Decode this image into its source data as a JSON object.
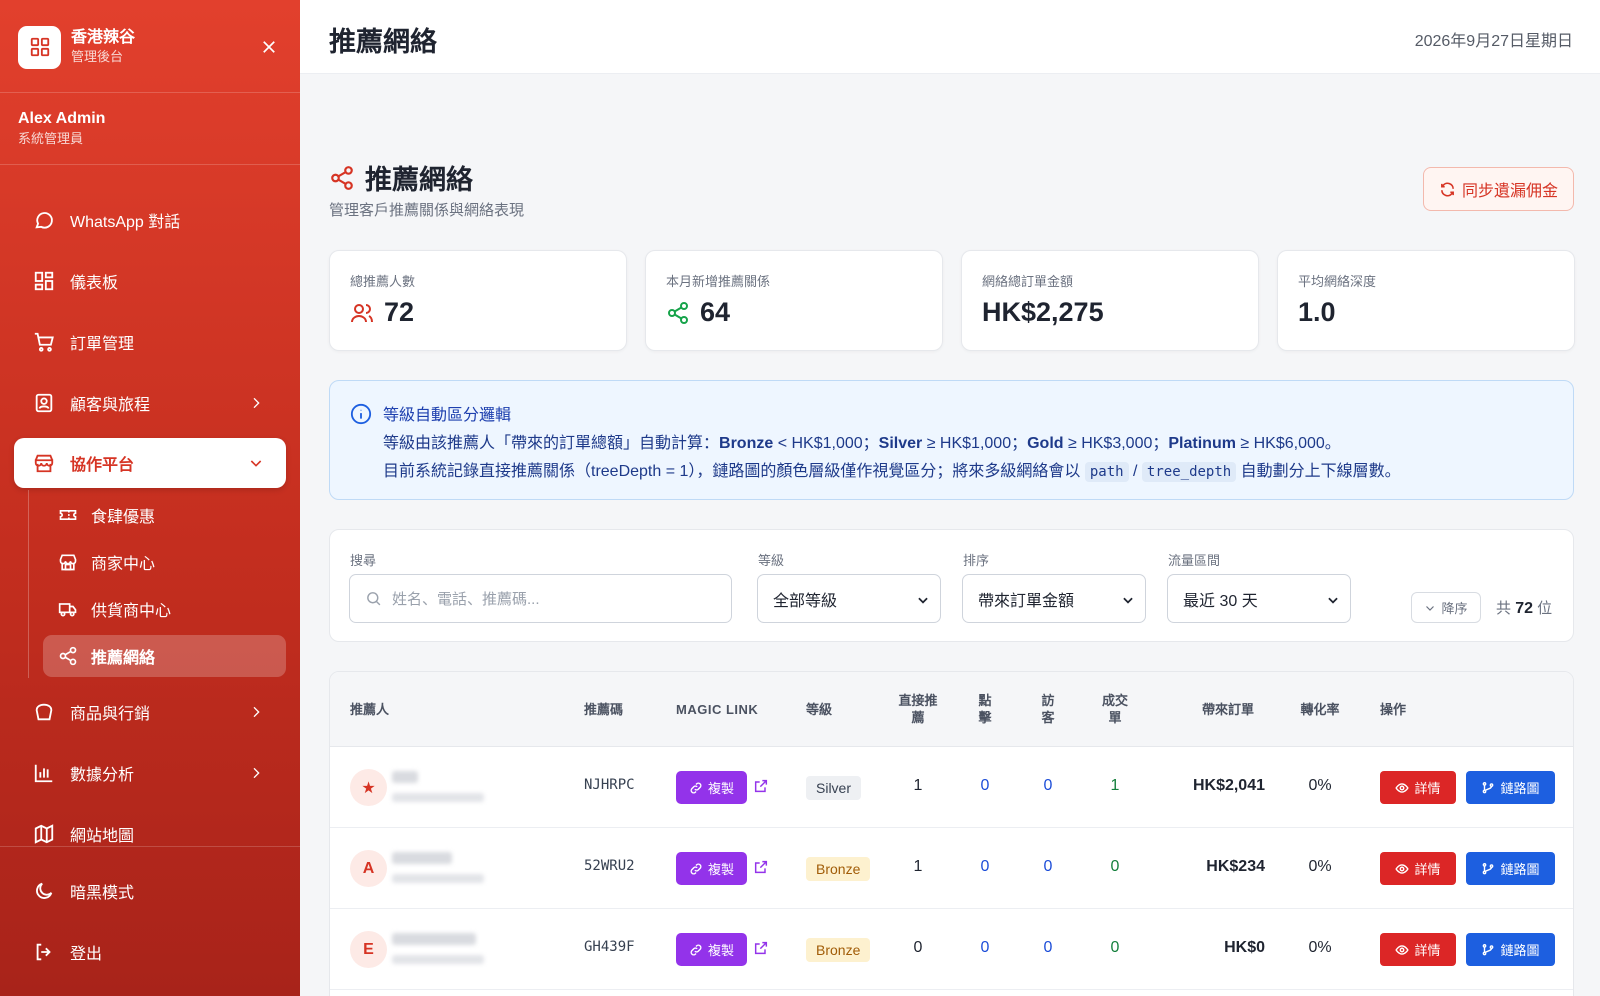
{
  "brand": {
    "name": "香港辣谷",
    "sub": "管理後台"
  },
  "user": {
    "name": "Alex Admin",
    "role": "系統管理員"
  },
  "nav": {
    "whatsapp": "WhatsApp 對話",
    "dashboard": "儀表板",
    "orders": "訂單管理",
    "customers": "顧客與旅程",
    "partners": "協作平台",
    "partner_sub": {
      "coupons": "食肆優惠",
      "merchants": "商家中心",
      "suppliers": "供貨商中心",
      "referrals": "推薦網絡"
    },
    "products": "商品與行銷",
    "analytics": "數據分析",
    "sitemap": "網站地圖",
    "dark_mode": "暗黑模式",
    "logout": "登出"
  },
  "header": {
    "title": "推薦網絡",
    "date": "2026年9月27日星期日"
  },
  "page": {
    "title": "推薦網絡",
    "subtitle": "管理客戶推薦關係與網絡表現",
    "sync_label": "同步遺漏佣金"
  },
  "stats": [
    {
      "label": "總推薦人數",
      "value": "72"
    },
    {
      "label": "本月新增推薦關係",
      "value": "64"
    },
    {
      "label": "網絡總訂單金額",
      "value": "HK$2,275"
    },
    {
      "label": "平均網絡深度",
      "value": "1.0"
    }
  ],
  "info": {
    "title": "等級自動區分邏輯",
    "line1_prefix": "等級由該推薦人「帶來的訂單總額」自動計算：",
    "tier_bronze": "Bronze",
    "tier_bronze_rule": " < HK$1,000；",
    "tier_silver": "Silver",
    "tier_silver_rule": " ≥ HK$1,000；",
    "tier_gold": "Gold",
    "tier_gold_rule": " ≥ HK$3,000；",
    "tier_platinum": "Platinum",
    "tier_platinum_rule": " ≥ HK$6,000。",
    "line2_prefix": "目前系統記錄直接推薦關係（treeDepth = 1），鏈路圖的顏色層級僅作視覺區分；將來多級網絡會以 ",
    "code_path": "path",
    "sep": " / ",
    "code_depth": "tree_depth",
    "line2_suffix": " 自動劃分上下線層數。"
  },
  "filters": {
    "search_label": "搜尋",
    "search_placeholder": "姓名、電話、推薦碼...",
    "tier_label": "等級",
    "tier_value": "全部等級",
    "sort_label": "排序",
    "sort_value": "帶來訂單金額",
    "range_label": "流量區間",
    "range_value": "最近 30 天",
    "order_label": "降序",
    "total_prefix": "共",
    "total_count": "72",
    "total_suffix": "位"
  },
  "table": {
    "headers": {
      "referrer": "推薦人",
      "code": "推薦碼",
      "magic": "MAGIC LINK",
      "tier": "等級",
      "direct_1": "直接推",
      "direct_2": "薦",
      "clicks_1": "點",
      "clicks_2": "擊",
      "visitors_1": "訪",
      "visitors_2": "客",
      "deals_1": "成交",
      "deals_2": "單",
      "orders": "帶來訂單",
      "conversion": "轉化率",
      "actions": "操作"
    },
    "copy_label": "複製",
    "detail_label": "詳情",
    "chain_label": "鏈路圖",
    "rows": [
      {
        "avatar": "★",
        "code": "NJHRPC",
        "tier": "Silver",
        "direct": "1",
        "clicks": "0",
        "visitors": "0",
        "deals": "1",
        "orders": "HK$2,041",
        "rate": "0%"
      },
      {
        "avatar": "A",
        "code": "52WRU2",
        "tier": "Bronze",
        "direct": "1",
        "clicks": "0",
        "visitors": "0",
        "deals": "0",
        "orders": "HK$234",
        "rate": "0%"
      },
      {
        "avatar": "E",
        "code": "GH439F",
        "tier": "Bronze",
        "direct": "0",
        "clicks": "0",
        "visitors": "0",
        "deals": "0",
        "orders": "HK$0",
        "rate": "0%"
      }
    ]
  },
  "colors": {
    "brand_red": "#d63424",
    "magic_purple": "#9333ea",
    "chain_blue": "#1d5fe0"
  }
}
